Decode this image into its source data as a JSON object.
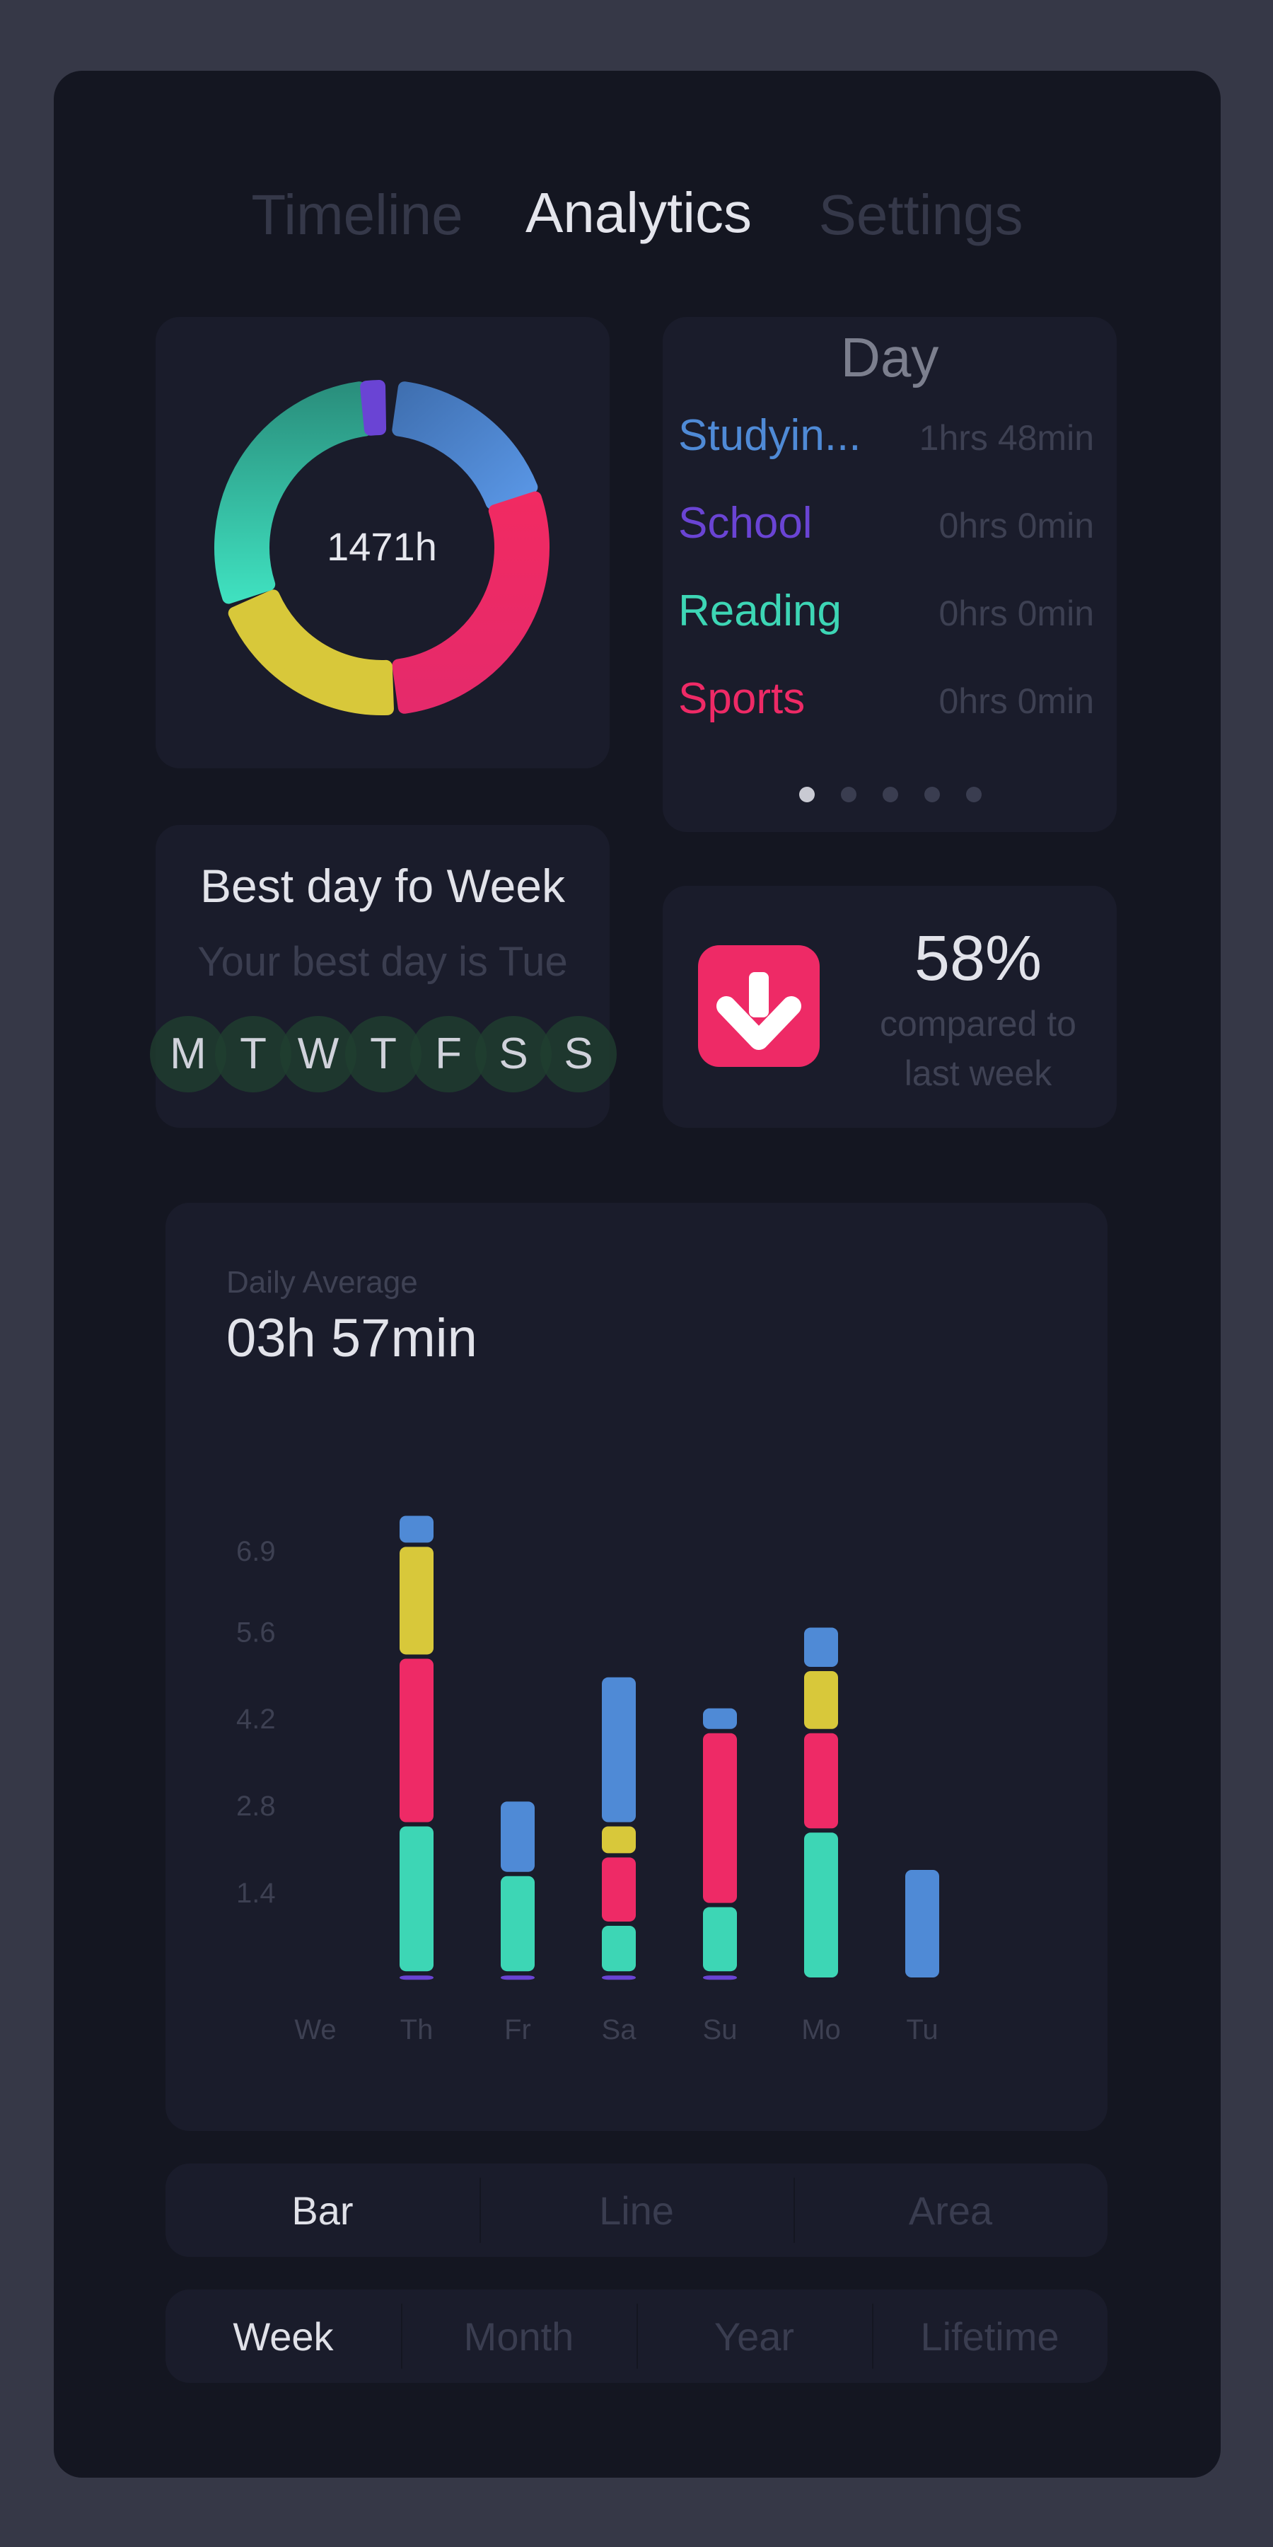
{
  "nav": {
    "tabs": [
      {
        "label": "Timeline",
        "active": false
      },
      {
        "label": "Analytics",
        "active": true
      },
      {
        "label": "Settings",
        "active": false
      }
    ]
  },
  "colors": {
    "studying": "#4f8ad6",
    "school": "#6a44d4",
    "reading": "#3dd6b5",
    "sports": "#ee2a66",
    "yellow": "#d8c83a"
  },
  "donut": {
    "center_label": "1471h"
  },
  "day_card": {
    "title": "Day",
    "rows": [
      {
        "label": "Studyin...",
        "value": "1hrs 48min",
        "color": "#4f8ad6"
      },
      {
        "label": "School",
        "value": "0hrs 0min",
        "color": "#6a44d4"
      },
      {
        "label": "Reading",
        "value": "0hrs 0min",
        "color": "#3dd6b5"
      },
      {
        "label": "Sports",
        "value": "0hrs 0min",
        "color": "#ee2a66"
      }
    ],
    "page_count": 5,
    "active_page": 0
  },
  "best_day": {
    "title": "Best day fo Week",
    "subtitle": "Your best day is Tue",
    "days": [
      "M",
      "T",
      "W",
      "T",
      "F",
      "S",
      "S"
    ]
  },
  "comparison": {
    "icon": "arrow-down-icon",
    "percent": "58%",
    "text_line1": "compared to",
    "text_line2": "last week"
  },
  "chart_card": {
    "caption": "Daily Average",
    "value": "03h 57min"
  },
  "chart_data": {
    "type": "bar",
    "stacked": true,
    "categories": [
      "We",
      "Th",
      "Fr",
      "Sa",
      "Su",
      "Mo",
      "Tu"
    ],
    "y_ticks": [
      "1.4",
      "2.8",
      "4.2",
      "5.6",
      "6.9"
    ],
    "ylim": [
      0,
      6.9
    ],
    "series": [
      {
        "key": "school",
        "color": "#6a44d4",
        "values": [
          0,
          0.1,
          0.1,
          0.1,
          0.1,
          0,
          0
        ]
      },
      {
        "key": "reading",
        "color": "#3dd6b5",
        "values": [
          0,
          2.4,
          1.6,
          0.8,
          1.1,
          2.4,
          0
        ]
      },
      {
        "key": "sports",
        "color": "#ee2a66",
        "values": [
          0,
          2.7,
          0,
          1.1,
          2.8,
          1.6,
          0
        ]
      },
      {
        "key": "yellow",
        "color": "#d8c83a",
        "values": [
          0,
          1.8,
          0,
          0.5,
          0,
          1.0,
          0
        ]
      },
      {
        "key": "studying",
        "color": "#4f8ad6",
        "values": [
          0,
          0.5,
          1.2,
          2.4,
          0.4,
          0.7,
          1.8
        ]
      }
    ]
  },
  "chart_type_toggle": {
    "options": [
      "Bar",
      "Line",
      "Area"
    ],
    "selected": "Bar"
  },
  "range_toggle": {
    "options": [
      "Week",
      "Month",
      "Year",
      "Lifetime"
    ],
    "selected": "Week"
  }
}
